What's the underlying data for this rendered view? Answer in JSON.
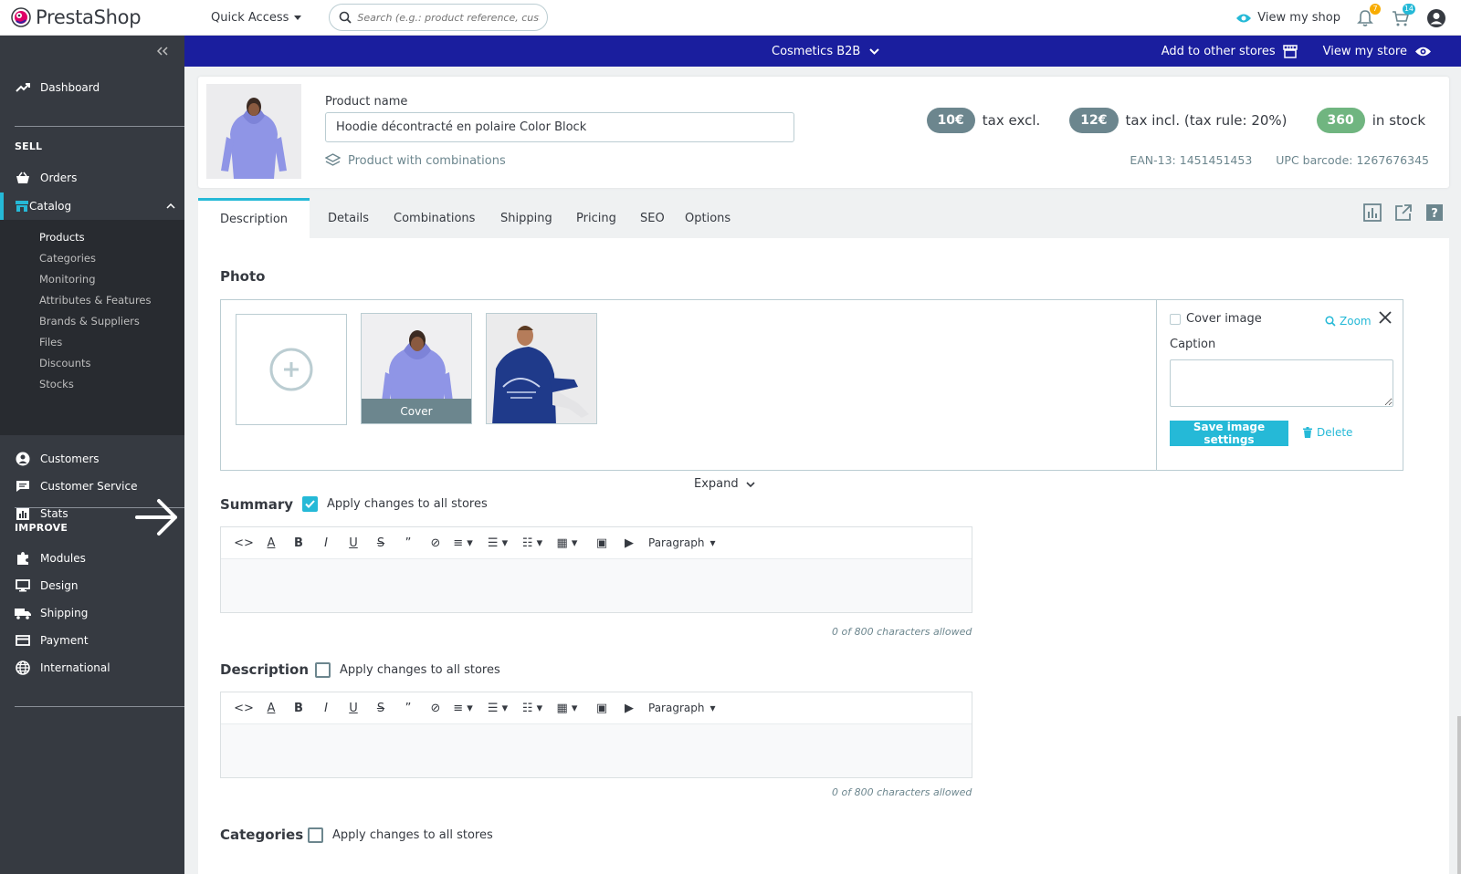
{
  "brand": {
    "name": "PrestaShop",
    "accent": "#25b9d7",
    "store_bar_color": "#1a1e9e"
  },
  "header": {
    "quick_access": "Quick Access",
    "search_placeholder": "Search (e.g.: product reference, customer",
    "view_my_shop": "View my shop",
    "notif_orders_count": "7",
    "notif_customers_count": "14"
  },
  "sidebar": {
    "dashboard": "Dashboard",
    "sell_title": "SELL",
    "orders": "Orders",
    "catalog": "Catalog",
    "catalog_items": [
      "Products",
      "Categories",
      "Monitoring",
      "Attributes & Features",
      "Brands & Suppliers",
      "Files",
      "Discounts",
      "Stocks"
    ],
    "customers": "Customers",
    "customer_service": "Customer Service",
    "stats": "Stats",
    "improve_title": "IMPROVE",
    "modules": "Modules",
    "design": "Design",
    "shipping": "Shipping",
    "payment": "Payment",
    "international": "International"
  },
  "storebar": {
    "store_name": "Cosmetics B2B",
    "add_to_other_stores": "Add to other stores",
    "view_my_store": "View my store"
  },
  "product": {
    "name_label": "Product name",
    "name_value": "Hoodie décontracté en polaire Color Block",
    "type": "Product with combinations",
    "price_excl": "10€",
    "price_excl_label": "tax excl.",
    "price_incl": "12€",
    "price_incl_label": "tax incl. (tax rule: 20%)",
    "stock": "360",
    "stock_label": "in stock",
    "ean": "EAN-13: 1451451453",
    "upc": "UPC barcode: 1267676345"
  },
  "tabs": [
    "Description",
    "Details",
    "Combinations",
    "Shipping",
    "Pricing",
    "SEO",
    "Options"
  ],
  "photo": {
    "title": "Photo",
    "cover_label": "Cover",
    "cover_image_label": "Cover image",
    "zoom": "Zoom",
    "caption_label": "Caption",
    "save_button": "Save image settings",
    "delete": "Delete",
    "expand": "Expand"
  },
  "summary": {
    "title": "Summary",
    "apply_label": "Apply changes to all stores",
    "apply_checked": true,
    "counter": "0 of 800 characters allowed"
  },
  "description": {
    "title": "Description",
    "apply_label": "Apply changes to all stores",
    "apply_checked": false,
    "counter": "0 of 800 characters allowed"
  },
  "categories": {
    "title": "Categories",
    "apply_label": "Apply changes to all stores"
  },
  "editor": {
    "paragraph": "Paragraph"
  }
}
